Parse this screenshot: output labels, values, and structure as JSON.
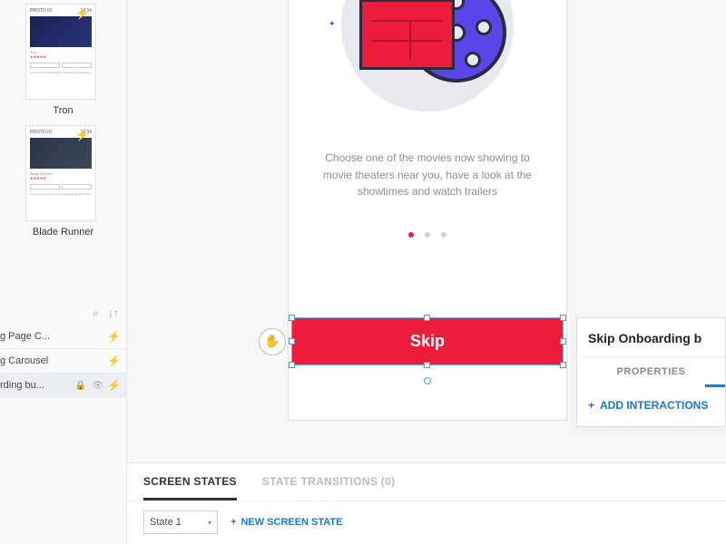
{
  "sidebar": {
    "thumbs": [
      {
        "label": "Tron"
      },
      {
        "label": "Blade Runner"
      }
    ],
    "layers": [
      {
        "label": "g Page C...",
        "selected": false,
        "bolt": true
      },
      {
        "label": "g Carousel",
        "selected": false,
        "bolt": true
      },
      {
        "label": "rding bu...",
        "selected": true,
        "bolt": true
      }
    ]
  },
  "canvas": {
    "movie_text": "Choose one of the movies now showing to movie theaters near you, have a look at the showtimes and watch trailers",
    "skip_label": "Skip"
  },
  "right_panel": {
    "title": "Skip Onboarding b",
    "tab": "PROPERTIES",
    "action": "ADD INTERACTIONS"
  },
  "bottom": {
    "tabs": [
      {
        "label": "SCREEN STATES",
        "active": true
      },
      {
        "label": "STATE TRANSITIONS (0)",
        "active": false
      }
    ],
    "state_selected": "State 1",
    "new_state": "NEW SCREEN STATE"
  }
}
